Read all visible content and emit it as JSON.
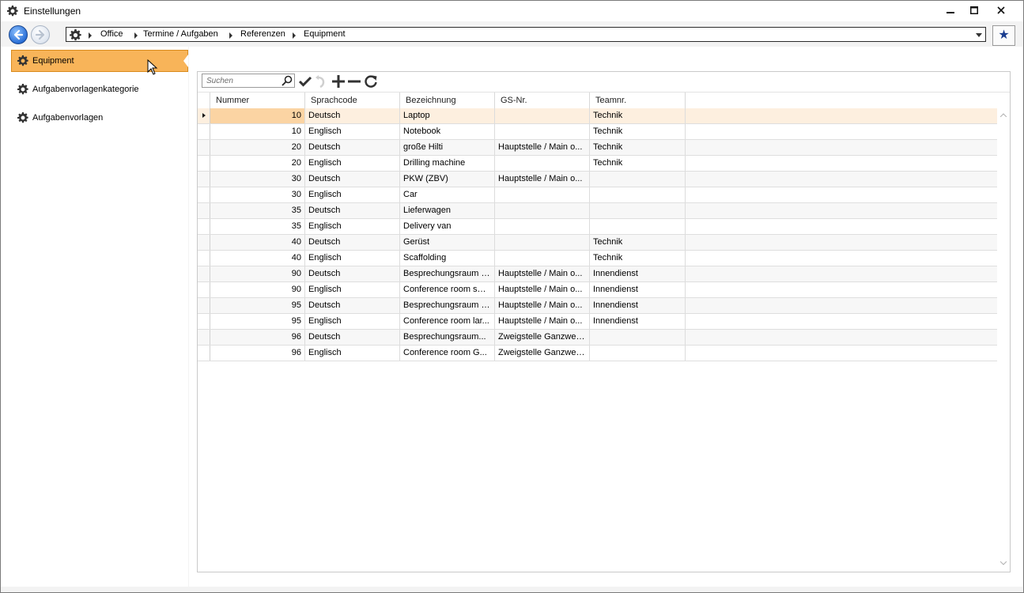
{
  "window": {
    "title": "Einstellungen"
  },
  "breadcrumb": [
    "Office",
    "Termine / Aufgaben",
    "Referenzen",
    "Equipment"
  ],
  "sidebar": {
    "items": [
      {
        "label": "Equipment",
        "active": true
      },
      {
        "label": "Aufgabenvorlagenkategorie",
        "active": false
      },
      {
        "label": "Aufgabenvorlagen",
        "active": false
      }
    ]
  },
  "toolbar": {
    "search_placeholder": "Suchen"
  },
  "table": {
    "columns": [
      "Nummer",
      "Sprachcode",
      "Bezeichnung",
      "GS-Nr.",
      "Teamnr."
    ],
    "rows": [
      [
        "10",
        "Deutsch",
        "Laptop",
        "",
        "Technik"
      ],
      [
        "10",
        "Englisch",
        "Notebook",
        "",
        "Technik"
      ],
      [
        "20",
        "Deutsch",
        "große Hilti",
        "Hauptstelle / Main o...",
        "Technik"
      ],
      [
        "20",
        "Englisch",
        "Drilling machine",
        "",
        "Technik"
      ],
      [
        "30",
        "Deutsch",
        "PKW (ZBV)",
        "Hauptstelle / Main o...",
        ""
      ],
      [
        "30",
        "Englisch",
        "Car",
        "",
        ""
      ],
      [
        "35",
        "Deutsch",
        "Lieferwagen",
        "",
        ""
      ],
      [
        "35",
        "Englisch",
        "Delivery van",
        "",
        ""
      ],
      [
        "40",
        "Deutsch",
        "Gerüst",
        "",
        "Technik"
      ],
      [
        "40",
        "Englisch",
        "Scaffolding",
        "",
        "Technik"
      ],
      [
        "90",
        "Deutsch",
        "Besprechungsraum k...",
        "Hauptstelle / Main o...",
        "Innendienst"
      ],
      [
        "90",
        "Englisch",
        "Conference room smal",
        "Hauptstelle / Main o...",
        "Innendienst"
      ],
      [
        "95",
        "Deutsch",
        "Besprechungsraum g...",
        "Hauptstelle / Main o...",
        "Innendienst"
      ],
      [
        "95",
        "Englisch",
        "Conference room lar...",
        "Hauptstelle / Main o...",
        "Innendienst"
      ],
      [
        "96",
        "Deutsch",
        "Besprechungsraum...",
        "Zweigstelle Ganzweit...",
        ""
      ],
      [
        "96",
        "Englisch",
        "Conference room G...",
        "Zweigstelle Ganzweit...",
        ""
      ]
    ],
    "selected_row": 0
  },
  "colors": {
    "accent": "#f8b459",
    "selected_row": "#fdefdf",
    "selected_cell": "#fbd4a3"
  }
}
